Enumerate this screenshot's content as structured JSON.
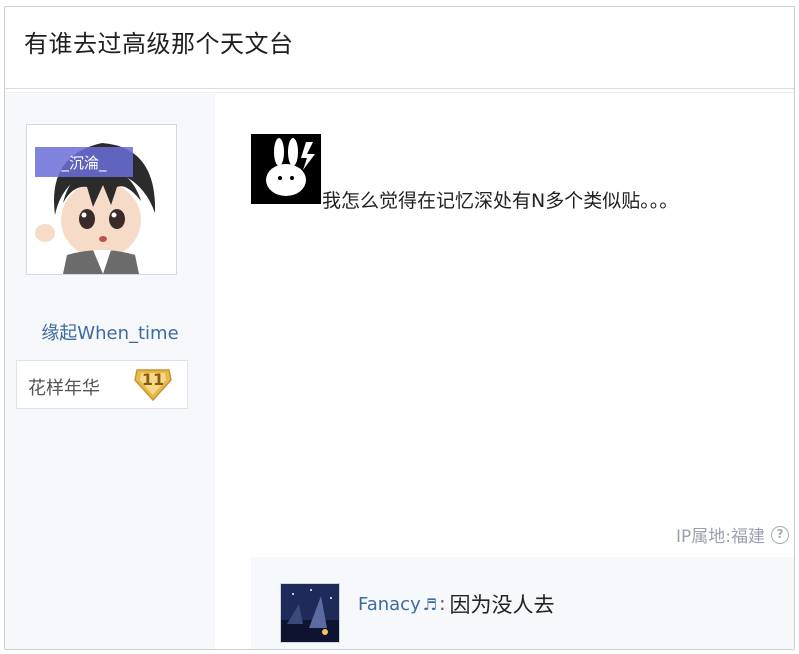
{
  "thread": {
    "title": "有谁去过高级那个天文台"
  },
  "author": {
    "name": "缘起When_time",
    "avatar_label": "_沉淪_",
    "badge_label": "花样年华",
    "badge_level": "11"
  },
  "post": {
    "text": "我怎么觉得在记忆深处有N多个类似贴。。。",
    "ip_location": "IP属地:福建",
    "help_icon_name": "question-circle-icon"
  },
  "reply": {
    "user": "Fanacy",
    "user_icon": "music-note-icon",
    "text": "因为没人去"
  },
  "colors": {
    "link": "#3d6aa0",
    "sidebar_bg": "#f6f8fc",
    "badge_gold": "#e8b94a"
  }
}
